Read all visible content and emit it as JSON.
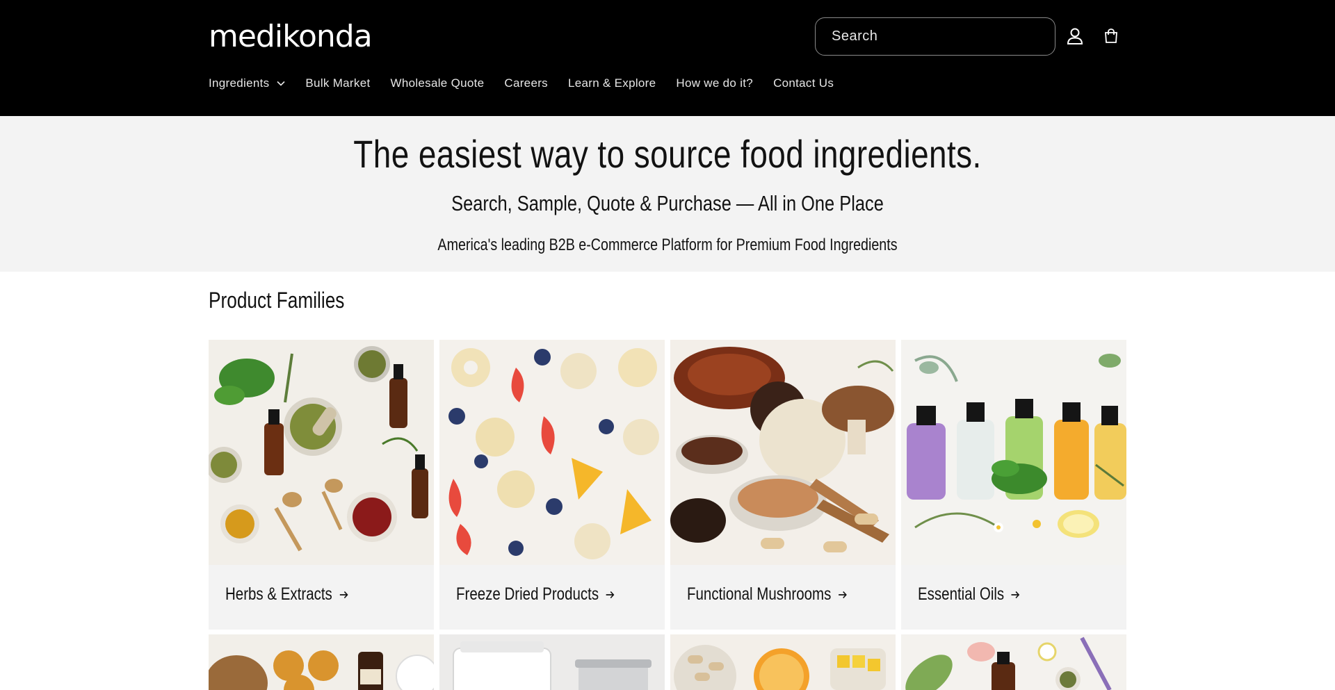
{
  "header": {
    "logo_text": "medikonda",
    "search_placeholder": "Search",
    "icons": [
      "account-icon",
      "cart-icon"
    ],
    "nav": [
      {
        "label": "Ingredients",
        "has_dropdown": true
      },
      {
        "label": "Bulk Market"
      },
      {
        "label": "Wholesale Quote"
      },
      {
        "label": "Careers"
      },
      {
        "label": "Learn & Explore"
      },
      {
        "label": "How we do it?"
      },
      {
        "label": "Contact Us"
      }
    ]
  },
  "hero": {
    "title": "The easiest way to source food ingredients.",
    "subtitle": "Search, Sample, Quote & Purchase — All in One Place",
    "tagline": "America's leading B2B e-Commerce Platform for Premium Food Ingredients"
  },
  "products": {
    "section_title": "Product Families",
    "cards": [
      {
        "label": "Herbs & Extracts"
      },
      {
        "label": "Freeze Dried Products"
      },
      {
        "label": "Functional Mushrooms"
      },
      {
        "label": "Essential Oils"
      }
    ]
  },
  "colors": {
    "header_bg": "#000000",
    "hero_bg": "#f3f3f3",
    "card_bg": "#f3f3f3",
    "text": "#121212"
  }
}
